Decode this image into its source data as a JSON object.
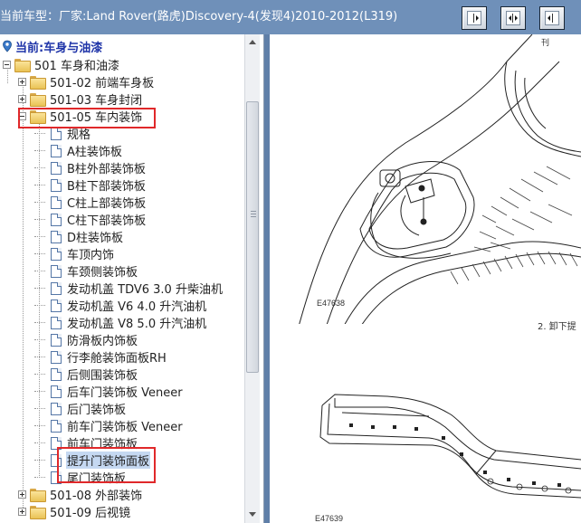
{
  "header": {
    "title": "当前车型：厂家:Land Rover(路虎)Discovery-4(发现4)2010-2012(L319)",
    "buttons": [
      {
        "icon": "expand-left-icon"
      },
      {
        "icon": "split-view-icon"
      },
      {
        "icon": "expand-right-icon"
      }
    ]
  },
  "tree": {
    "root": "当前:车身与油漆",
    "items": [
      {
        "label": "501 车身和油漆",
        "type": "folder",
        "level": 0,
        "expander": "minus"
      },
      {
        "label": "501-02 前端车身板",
        "type": "folder",
        "level": 1,
        "expander": "plus"
      },
      {
        "label": "501-03 车身封闭",
        "type": "folder",
        "level": 1,
        "expander": "plus"
      },
      {
        "label": "501-05 车内装饰",
        "type": "folder",
        "level": 1,
        "expander": "minus"
      },
      {
        "label": "规格",
        "type": "doc",
        "level": 2
      },
      {
        "label": "A柱装饰板",
        "type": "doc",
        "level": 2
      },
      {
        "label": "B柱外部装饰板",
        "type": "doc",
        "level": 2
      },
      {
        "label": "B柱下部装饰板",
        "type": "doc",
        "level": 2
      },
      {
        "label": "C柱上部装饰板",
        "type": "doc",
        "level": 2
      },
      {
        "label": "C柱下部装饰板",
        "type": "doc",
        "level": 2
      },
      {
        "label": "D柱装饰板",
        "type": "doc",
        "level": 2
      },
      {
        "label": "车顶内饰",
        "type": "doc",
        "level": 2
      },
      {
        "label": "车颈侧装饰板",
        "type": "doc",
        "level": 2
      },
      {
        "label": "发动机盖 TDV6 3.0 升柴油机",
        "type": "doc",
        "level": 2
      },
      {
        "label": "发动机盖 V6 4.0 升汽油机",
        "type": "doc",
        "level": 2
      },
      {
        "label": "发动机盖 V8 5.0 升汽油机",
        "type": "doc",
        "level": 2
      },
      {
        "label": "防滑板内饰板",
        "type": "doc",
        "level": 2
      },
      {
        "label": "行李舱装饰面板RH",
        "type": "doc",
        "level": 2
      },
      {
        "label": "后侧围装饰板",
        "type": "doc",
        "level": 2
      },
      {
        "label": "后车门装饰板 Veneer",
        "type": "doc",
        "level": 2
      },
      {
        "label": "后门装饰板",
        "type": "doc",
        "level": 2
      },
      {
        "label": "前车门装饰板 Veneer",
        "type": "doc",
        "level": 2
      },
      {
        "label": "前车门装饰板",
        "type": "doc",
        "level": 2
      },
      {
        "label": "提升门装饰面板",
        "type": "doc",
        "level": 2,
        "selected": true
      },
      {
        "label": "尾门装饰板",
        "type": "doc",
        "level": 2
      },
      {
        "label": "501-08 外部装饰",
        "type": "folder",
        "level": 1,
        "expander": "plus"
      },
      {
        "label": "501-09 后视镜",
        "type": "folder",
        "level": 1,
        "expander": "plus"
      }
    ]
  },
  "document": {
    "figure1_id": "E47638",
    "figure2_id": "E47639",
    "step_text": "2. 卸下提",
    "top_fragment": "刊"
  },
  "colors": {
    "header_bg": "#6f90b9",
    "tree_root_text": "#1f34a8",
    "highlight_box": "#e0282a",
    "selected_bg": "#c5d8f1"
  }
}
